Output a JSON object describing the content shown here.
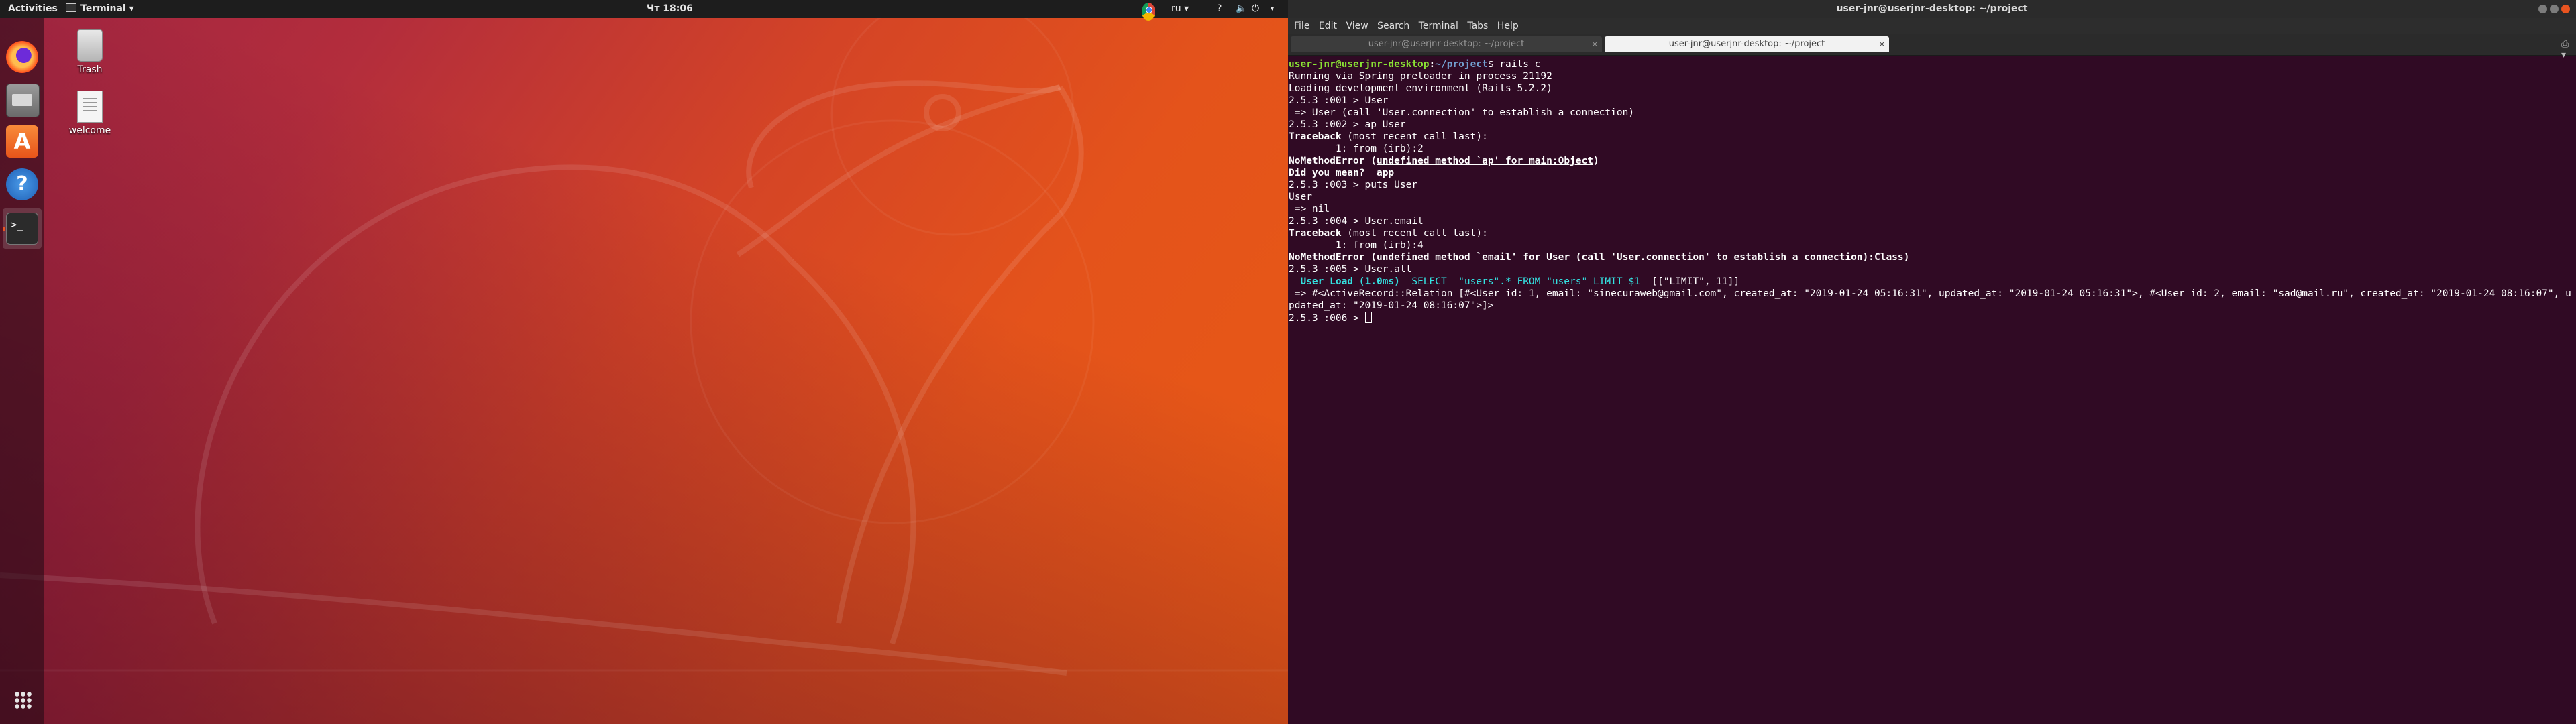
{
  "top_panel": {
    "activities": "Activities",
    "app_menu": "Terminal",
    "app_menu_arrow": "▾",
    "clock": "Чт 18:06",
    "lang": "ru ▾",
    "help": "?",
    "sound": "🔈",
    "power": "⏻",
    "arrow": "▾"
  },
  "desktop_icons": [
    {
      "label": "Trash",
      "icon": "trash-icon"
    },
    {
      "label": "welcome",
      "icon": "text-file-icon"
    }
  ],
  "dock": {
    "items": [
      "firefox-icon",
      "files-icon",
      "software-icon",
      "help-icon",
      "terminal-icon",
      "show-apps-icon"
    ],
    "software_glyph": "A",
    "help_glyph": "?",
    "terminal_glyph": ">_"
  },
  "terminal_window": {
    "title": "user-jnr@userjnr-desktop: ~/project",
    "menu": [
      "File",
      "Edit",
      "View",
      "Search",
      "Terminal",
      "Tabs",
      "Help"
    ],
    "tabs": [
      {
        "label": "user-jnr@userjnr-desktop: ~/project",
        "active": false
      },
      {
        "label": "user-jnr@userjnr-desktop: ~/project",
        "active": true
      }
    ],
    "tab_close": "×",
    "new_tab": "⎙ ▾",
    "lines": {
      "l1_user": "user-jnr@userjnr-desktop",
      "l1_sep": ":",
      "l1_path": "~/project",
      "l1_cmd": "$ rails c",
      "l2": "Running via Spring preloader in process 21192",
      "l3": "Loading development environment (Rails 5.2.2)",
      "l4": "2.5.3 :001 > User",
      "l5": " => User (call 'User.connection' to establish a connection)",
      "l6": "2.5.3 :002 > ap User",
      "l7_a": "Traceback",
      "l7_b": " (most recent call last):",
      "l8": "        1: from (irb):2",
      "l9_a": "NoMethodError",
      "l9_b": " (",
      "l9_c": "undefined method `ap' for main:Object",
      "l9_d": ")",
      "l10_a": "Did you mean?",
      "l10_b": "  app",
      "l11": "2.5.3 :003 > puts User",
      "l12": "User",
      "l13": " => nil",
      "l14": "2.5.3 :004 > User.email",
      "l15_a": "Traceback",
      "l15_b": " (most recent call last):",
      "l16": "        1: from (irb):4",
      "l17_a": "NoMethodError",
      "l17_b": " (",
      "l17_c": "undefined method `email' for User (call 'User.connection' to establish a connection):Class",
      "l17_d": ")",
      "l18": "2.5.3 :005 > User.all",
      "l19_a": "  User Load (1.0ms)",
      "l19_b": "  SELECT  \"users\".* FROM \"users\" LIMIT $1",
      "l19_c": "  [[\"LIMIT\", 11]]",
      "l20": " => #<ActiveRecord::Relation [#<User id: 1, email: \"sinecuraweb@gmail.com\", created_at: \"2019-01-24 05:16:31\", updated_at: \"2019-01-24 05:16:31\">, #<User id: 2, email: \"sad@mail.ru\", created_at: \"2019-01-24 08:16:07\", updated_at: \"2019-01-24 08:16:07\">]>",
      "l21": "2.5.3 :006 > "
    }
  },
  "colors": {
    "terminal_bg": "#300a24",
    "prompt_user": "#8ae234",
    "prompt_path": "#729fcf",
    "accent": "#e95420"
  }
}
